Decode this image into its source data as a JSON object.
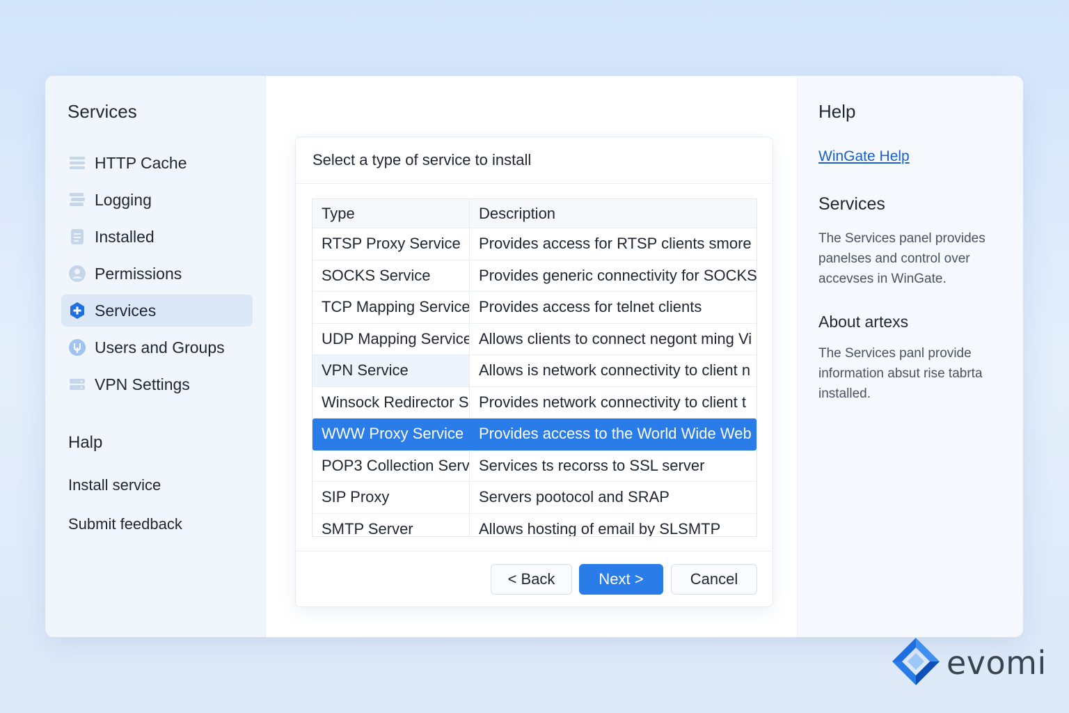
{
  "sidebar": {
    "title": "Services",
    "items": [
      {
        "label": "HTTP Cache",
        "icon": "list-icon"
      },
      {
        "label": "Logging",
        "icon": "log-icon"
      },
      {
        "label": "Installed",
        "icon": "document-icon"
      },
      {
        "label": "Permissions",
        "icon": "user-icon"
      },
      {
        "label": "Services",
        "icon": "services-plus-icon",
        "active": true
      },
      {
        "label": "Users and Groups",
        "icon": "users-icon"
      },
      {
        "label": "VPN Settings",
        "icon": "vpn-icon"
      }
    ],
    "help_heading": "Halp",
    "help_links": [
      "Install service",
      "Submit feedback"
    ]
  },
  "dialog": {
    "title": "Select a type of service to install",
    "columns": [
      "Type",
      "Description"
    ],
    "rows": [
      {
        "type": "RTSP Proxy Service",
        "description": "Provides access for RTSP clients smore"
      },
      {
        "type": "SOCKS Service",
        "description": "Provides generic connectivity for SOCKS"
      },
      {
        "type": "TCP Mapping Service",
        "description": "Provides access for telnet clients"
      },
      {
        "type": "UDP Mapping Service",
        "description": "Allows clients to connect negont ming Vi"
      },
      {
        "type": "VPN Service",
        "description": "Allows is network connectivity to client n"
      },
      {
        "type": "Winsock Redirector S.",
        "description": "Provides network connectivity to client t"
      },
      {
        "type": "WWW Proxy Service",
        "description": "Provides access to the World Wide Web u",
        "selected": true
      },
      {
        "type": "POP3 Collection Serv",
        "description": "Services ts recorss to SSL server"
      },
      {
        "type": "SIP Proxy",
        "description": "Servers pootocol and SRAP"
      },
      {
        "type": "SMTP Server",
        "description": "Allows hosting of email by SLSMTP"
      }
    ],
    "buttons": {
      "back": "< Back",
      "next": "Next >",
      "cancel": "Cancel"
    }
  },
  "help_panel": {
    "title": "Help",
    "link": "WinGate Help",
    "section1_title": "Services",
    "section1_text": "The Services panel provides panelses and control over accevses in WinGate.",
    "section2_title": "About artexs",
    "section2_text": "The Services panl provide information absut rise tabrta installed."
  },
  "brand": {
    "name": "evomi"
  },
  "colors": {
    "accent": "#2a7de9",
    "link": "#1a5fcc",
    "sidebar_bg": "#f1f6fd"
  }
}
